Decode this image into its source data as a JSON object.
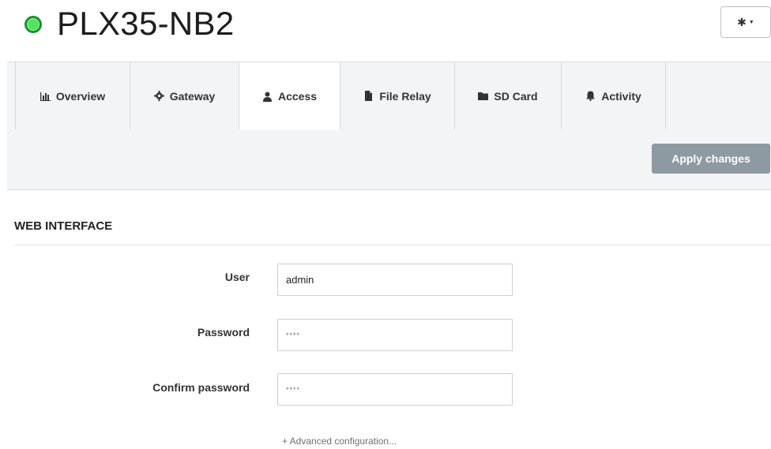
{
  "header": {
    "title": "PLX35-NB2",
    "status_color": "#54e35f",
    "settings_icon": "gear-icon"
  },
  "tabs": [
    {
      "label": "Overview",
      "icon": "bar-chart-icon",
      "active": false
    },
    {
      "label": "Gateway",
      "icon": "gear-icon",
      "active": false
    },
    {
      "label": "Access",
      "icon": "user-icon",
      "active": true
    },
    {
      "label": "File Relay",
      "icon": "file-icon",
      "active": false
    },
    {
      "label": "SD Card",
      "icon": "folder-icon",
      "active": false
    },
    {
      "label": "Activity",
      "icon": "bell-icon",
      "active": false
    }
  ],
  "toolbar": {
    "apply_label": "Apply changes",
    "apply_color": "#8e9aa2"
  },
  "web_interface": {
    "title": "WEB INTERFACE",
    "user_label": "User",
    "user_value": "admin",
    "password_label": "Password",
    "password_placeholder": "****",
    "confirm_label": "Confirm password",
    "confirm_placeholder": "****",
    "advanced_link": "+ Advanced configuration..."
  }
}
